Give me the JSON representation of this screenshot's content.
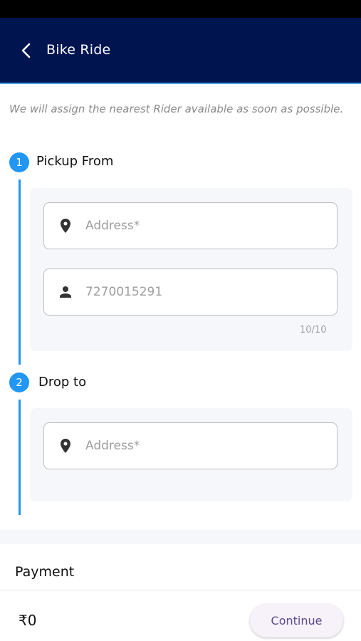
{
  "app_bar": {
    "title": "Bike Ride"
  },
  "info_text": "We will assign the nearest Rider available as soon as possible.",
  "pickup": {
    "step_number": "1",
    "title": "Pickup From",
    "address_placeholder": "Address*",
    "phone_value": "7270015291",
    "phone_counter": "10/10"
  },
  "drop": {
    "step_number": "2",
    "title": "Drop to",
    "address_placeholder": "Address*"
  },
  "payment": {
    "title": "Payment"
  },
  "footer": {
    "amount": "₹0",
    "continue_label": "Continue"
  },
  "colors": {
    "app_bar": "#001450",
    "accent": "#2196f3"
  },
  "icons": {
    "back": "chevron-left-icon",
    "location": "location-pin-icon",
    "person": "person-icon"
  }
}
